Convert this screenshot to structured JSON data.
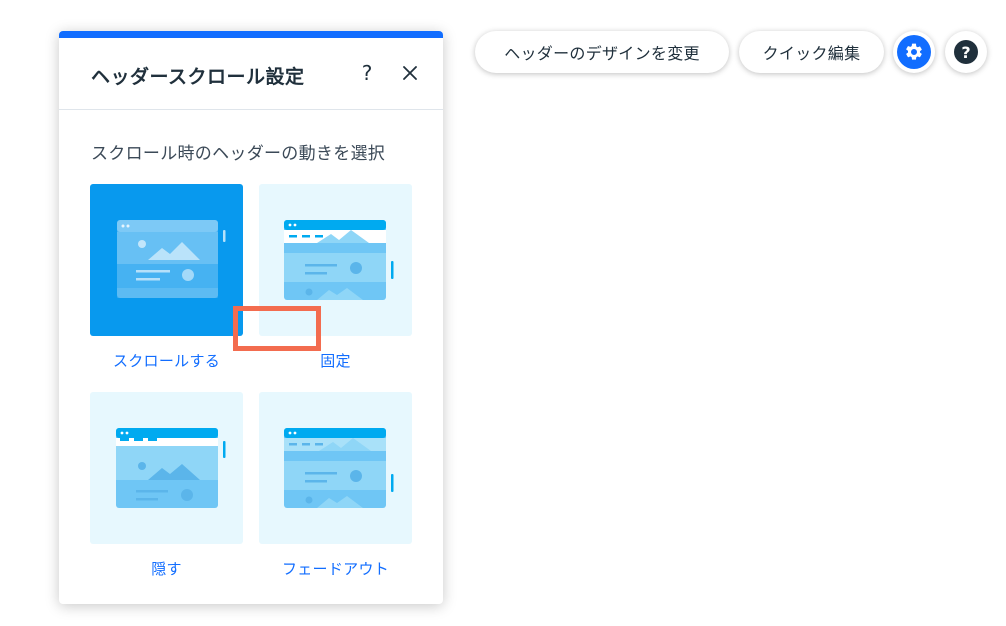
{
  "panel": {
    "title": "ヘッダースクロール設定",
    "help_label": "?",
    "subtitle": "スクロール時のヘッダーの動きを選択",
    "options": [
      {
        "label": "スクロールする",
        "selected": true
      },
      {
        "label": "固定",
        "selected": false
      },
      {
        "label": "隠す",
        "selected": false
      },
      {
        "label": "フェードアウト",
        "selected": false
      }
    ]
  },
  "toolbar": {
    "change_design_label": "ヘッダーのデザインを変更",
    "quick_edit_label": "クイック編集",
    "help_label": "?"
  },
  "colors": {
    "accent": "#116dff",
    "selected_tile": "#0899ee",
    "tile_bg": "#e7f8fe",
    "highlight": "#f36c4f"
  }
}
